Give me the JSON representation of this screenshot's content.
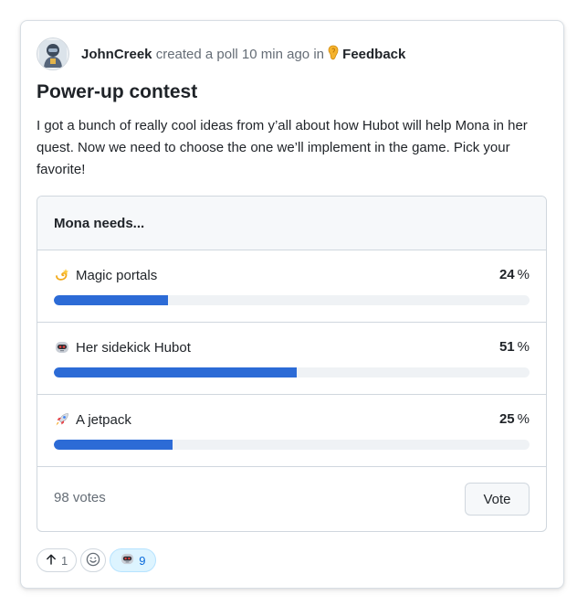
{
  "post": {
    "author": "JohnCreek",
    "action_text": "created a poll 10 min ago in",
    "category": "Feedback",
    "title": "Power-up contest",
    "body": "I got a bunch of really cool ideas from y’all about how Hubot will help Mona in her quest. Now we need to choose the one we’ll implement in the game. Pick your favorite!"
  },
  "poll": {
    "question": "Mona needs...",
    "options": [
      {
        "label": "Magic portals",
        "percent": 24,
        "percent_text": "24",
        "icon": "dizzy-star-icon"
      },
      {
        "label": "Her sidekick Hubot",
        "percent": 51,
        "percent_text": "51",
        "icon": "hubot-icon"
      },
      {
        "label": "A jetpack",
        "percent": 25,
        "percent_text": "25",
        "icon": "rocket-icon"
      }
    ],
    "percent_sign": "%",
    "votes_text": "98 votes",
    "vote_label": "Vote"
  },
  "reactions": {
    "upvote_count": "1",
    "hubot_count": "9"
  },
  "colors": {
    "bar_fill": "#2c6bd6",
    "bar_track": "#eff2f5",
    "active_reaction_bg": "#ddf4ff"
  }
}
